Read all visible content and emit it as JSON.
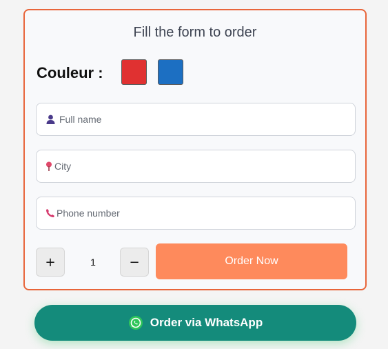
{
  "form": {
    "title": "Fill the form to order",
    "color_label": "Couleur :",
    "colors": [
      {
        "name": "red",
        "hex": "#e03131"
      },
      {
        "name": "blue",
        "hex": "#1c6fc2"
      }
    ],
    "fields": {
      "full_name": {
        "placeholder": "Full name",
        "icon": "person-icon",
        "value": ""
      },
      "city": {
        "placeholder": "City",
        "icon": "location-pin-icon",
        "value": ""
      },
      "phone": {
        "placeholder": "Phone number",
        "icon": "phone-icon",
        "value": ""
      }
    },
    "quantity": {
      "plus_label": "+",
      "value": "1",
      "minus_label": "−"
    },
    "order_button_label": "Order Now",
    "accent_color": "#e8653a",
    "order_button_color": "#fe8a5c"
  },
  "whatsapp": {
    "label": "Order via WhatsApp",
    "icon": "whatsapp-icon",
    "color": "#148b7b"
  }
}
